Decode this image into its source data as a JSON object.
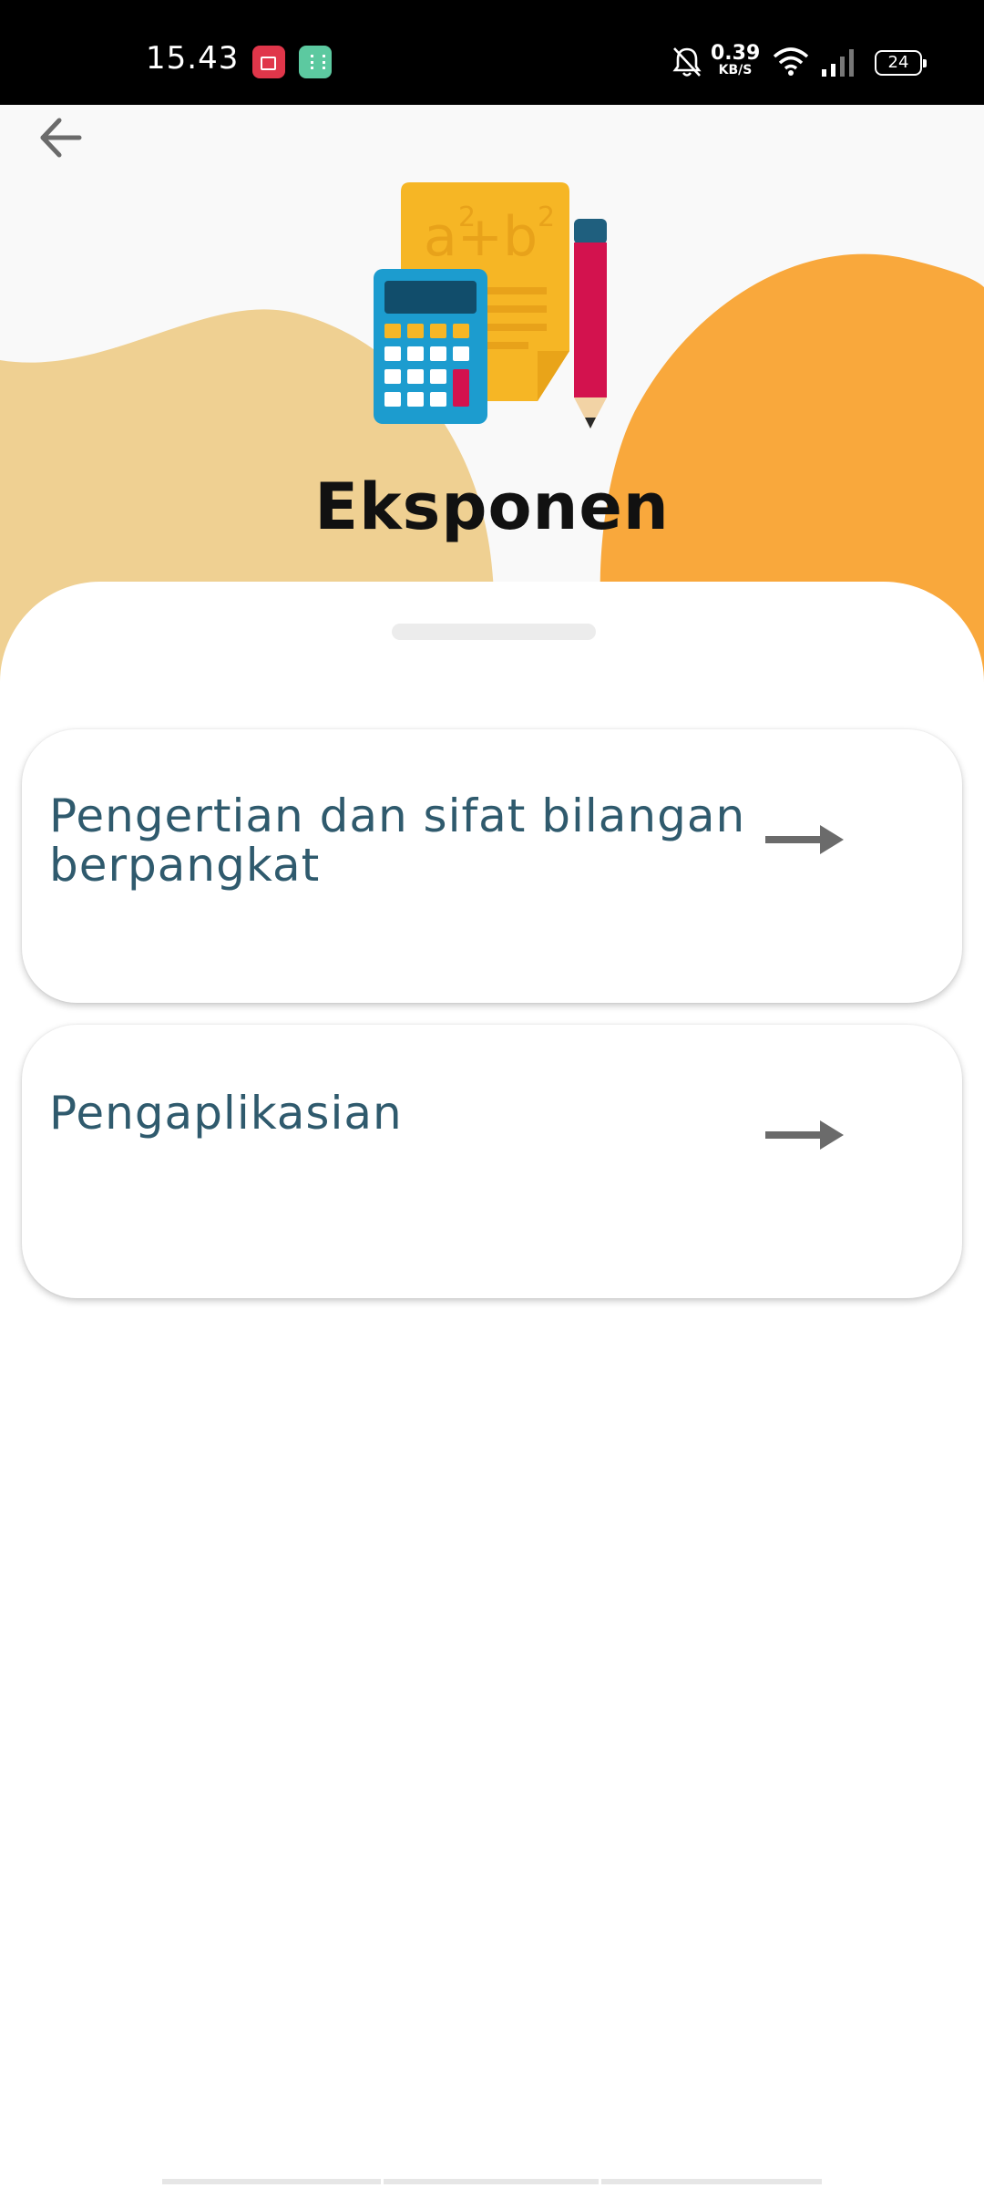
{
  "status_bar": {
    "time": "15.43",
    "net_speed_value": "0.39",
    "net_speed_unit": "KB/S",
    "battery_level": "24",
    "icons": [
      "screen-recorder-icon",
      "app-notification-icon",
      "bell-off-icon",
      "wifi-icon",
      "signal-icon",
      "battery-icon"
    ]
  },
  "header": {
    "back_icon": "arrow-left-icon",
    "illustration": "math-tools-illustration",
    "title": "Eksponen"
  },
  "menu": {
    "items": [
      {
        "label": "Pengertian dan sifat bilangan berpangkat",
        "icon": "arrow-right-icon"
      },
      {
        "label": "Pengaplikasian",
        "icon": "arrow-right-icon"
      }
    ]
  },
  "colors": {
    "blob_left": "#efd092",
    "blob_right": "#f9a83c",
    "card_text": "#2f5a6d",
    "arrow": "#6b6b6b",
    "title": "#111111"
  }
}
